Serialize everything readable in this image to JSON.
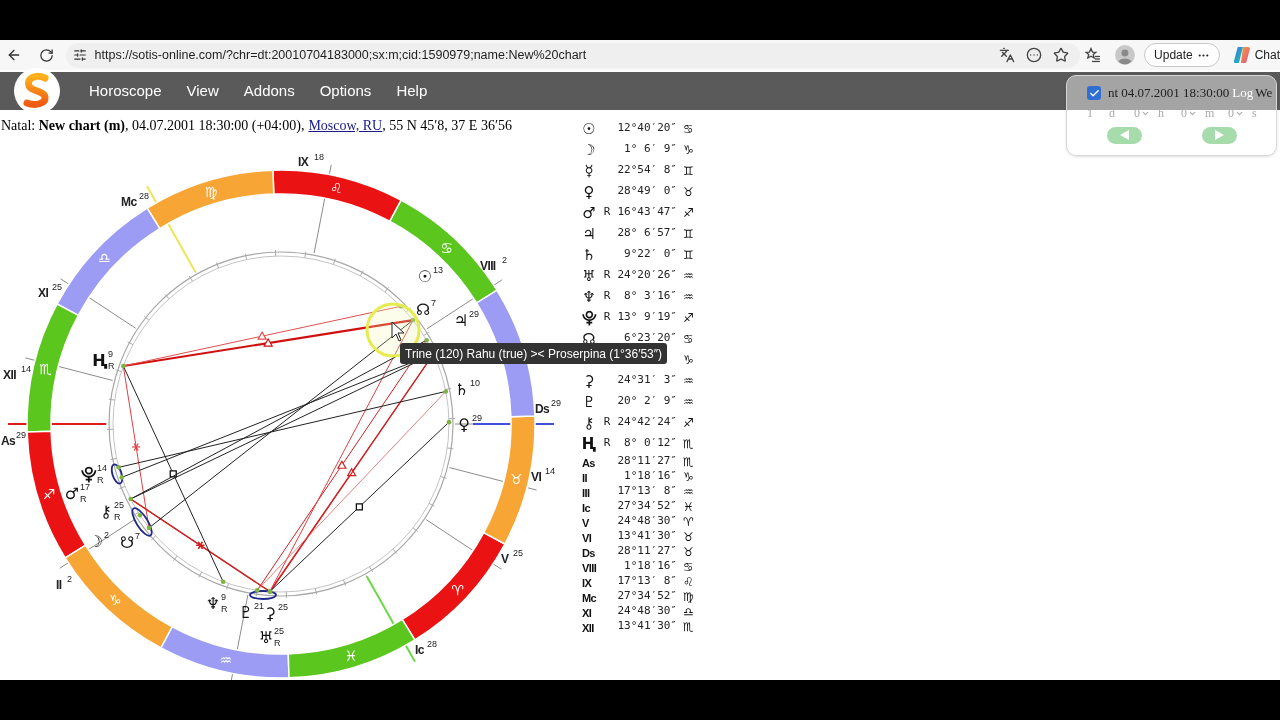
{
  "browser": {
    "url": "https://sotis-online.com/?chr=dt:20010704183000;sx:m;cid:1590979;name:New%20chart",
    "update_label": "Update",
    "chat_label": "Chat"
  },
  "menu": {
    "items": [
      "Horoscope",
      "View",
      "Addons",
      "Options",
      "Help"
    ],
    "login": "Log"
  },
  "time_panel": {
    "checked": true,
    "title": "nt 04.07.2001 18:30:00",
    "title_end": "We",
    "steps": [
      {
        "kind": "input",
        "value": "1",
        "unit": "d"
      },
      {
        "kind": "select",
        "value": "0",
        "unit": "h"
      },
      {
        "kind": "select",
        "value": "0",
        "unit": "m"
      },
      {
        "kind": "select",
        "value": "0",
        "unit": "s"
      }
    ]
  },
  "chart_info": {
    "text": "Natal: **New chart (m)**, 04.07.2001 18:30:00 (+04:00),",
    "place_link": "Moscow, RU",
    "coords": ", 55 N 45′8, 37 E 36′56"
  },
  "wheel": {
    "signs": [
      {
        "glyph": "♈",
        "color": "#ea1212"
      },
      {
        "glyph": "♉",
        "color": "#f7a534"
      },
      {
        "color": "#9c9cf5"
      },
      {
        "glyph": "♋",
        "color": "#5ac61e"
      },
      {
        "glyph": "♌",
        "color": "#ea1212"
      },
      {
        "glyph": "♍",
        "color": "#f7a534"
      },
      {
        "glyph": "♎",
        "color": "#9c9cf5"
      },
      {
        "glyph": "♏",
        "color": "#5ac61e"
      },
      {
        "glyph": "♐",
        "color": "#ea1212"
      },
      {
        "glyph": "♑",
        "color": "#f7a534"
      },
      {
        "glyph": "♒",
        "color": "#9c9cf5"
      },
      {
        "glyph": "♓",
        "color": "#5ac61e"
      }
    ],
    "houses": [
      {
        "label": "As",
        "degree": "29"
      },
      {
        "label": "II",
        "degree": "2"
      },
      {
        "label": "Ic",
        "degree": "28"
      },
      {
        "label": "V",
        "degree": "25"
      },
      {
        "label": "VI",
        "degree": "14"
      },
      {
        "label": "Ds",
        "degree": "29"
      },
      {
        "label": "VIII",
        "degree": "2"
      },
      {
        "label": "IX",
        "degree": "18"
      },
      {
        "label": "Mc",
        "degree": "28"
      },
      {
        "label": "XI",
        "degree": "25"
      },
      {
        "label": "XII",
        "degree": "14"
      }
    ],
    "planets": [
      {
        "glyph": "☉",
        "degree": "13"
      },
      {
        "glyph": "☊",
        "degree": "7"
      },
      {
        "glyph": "♃",
        "degree": "29"
      },
      {
        "glyph": "♄",
        "degree": "10"
      },
      {
        "glyph": "♀",
        "degree": "29"
      },
      {
        "glyph": "Ⱨ",
        "degree": "9",
        "retro": "R"
      },
      {
        "glyph": "⯓",
        "degree": "14",
        "retro": "R"
      },
      {
        "glyph": "♂",
        "degree": "17",
        "retro": "R"
      },
      {
        "glyph": "⚷",
        "degree": "25",
        "retro": "R"
      },
      {
        "glyph": "☽",
        "degree": "2"
      },
      {
        "glyph": "☋",
        "degree": "7"
      },
      {
        "glyph": "♆",
        "degree": "9",
        "retro": "R"
      },
      {
        "glyph": "♇",
        "degree": "21"
      },
      {
        "glyph": "⚳",
        "degree": "25"
      },
      {
        "glyph": "♅",
        "degree": "25",
        "retro": "R"
      }
    ],
    "tooltip": "Trine (120) Rahu (true) >< Proserpina (1°36′53″)"
  },
  "positions": [
    {
      "kind": "body",
      "glyph": "☉",
      "position": "12°40′20″",
      "sign": "♋"
    },
    {
      "kind": "body",
      "glyph": "☽",
      "position": "1° 6′ 9″",
      "sign": "♑"
    },
    {
      "kind": "body",
      "glyph": "☿",
      "position": "22°54′ 8″",
      "sign": "♊"
    },
    {
      "kind": "body",
      "glyph": "♀",
      "position": "28°49′ 0″",
      "sign": "♉"
    },
    {
      "kind": "body",
      "glyph": "♂",
      "retro": "R",
      "position": "16°43′47″",
      "sign": "♐"
    },
    {
      "kind": "body",
      "glyph": "♃",
      "position": "28° 6′57″",
      "sign": "♊"
    },
    {
      "kind": "body",
      "glyph": "♄",
      "position": "9°22′ 0″",
      "sign": "♊"
    },
    {
      "kind": "body",
      "glyph": "♅",
      "retro": "R",
      "position": "24°20′26″",
      "sign": "♒"
    },
    {
      "kind": "body",
      "glyph": "♆",
      "retro": "R",
      "position": "8° 3′16″",
      "sign": "♒"
    },
    {
      "kind": "body",
      "glyph": "⯓",
      "retro": "R",
      "position": "13° 9′19″",
      "sign": "♐"
    },
    {
      "kind": "body",
      "glyph": "☊",
      "position": "6°23′20″",
      "sign": "♋"
    },
    {
      "kind": "body",
      "sign": "♑"
    },
    {
      "kind": "body",
      "glyph": "⚳",
      "position": "24°31′ 3″",
      "sign": "♒"
    },
    {
      "kind": "body",
      "glyph": "♇",
      "position": "20° 2′ 9″",
      "sign": "♒"
    },
    {
      "kind": "body",
      "glyph": "⚷",
      "retro": "R",
      "position": "24°42′24″",
      "sign": "♐"
    },
    {
      "kind": "body",
      "glyph": "Ⱨ",
      "retro": "R",
      "position": "8° 0′12″",
      "sign": "♏"
    },
    {
      "kind": "cusp",
      "label": "As",
      "position": "28°11′27″",
      "sign": "♏"
    },
    {
      "kind": "cusp",
      "label": "II",
      "position": "1°18′16″",
      "sign": "♑"
    },
    {
      "kind": "cusp",
      "label": "III",
      "position": "17°13′ 8″",
      "sign": "♒"
    },
    {
      "kind": "cusp",
      "label": "Ic",
      "position": "27°34′52″",
      "sign": "♓"
    },
    {
      "kind": "cusp",
      "label": "V",
      "position": "24°48′30″",
      "sign": "♈"
    },
    {
      "kind": "cusp",
      "label": "VI",
      "position": "13°41′30″",
      "sign": "♉"
    },
    {
      "kind": "cusp",
      "label": "Ds",
      "position": "28°11′27″",
      "sign": "♉"
    },
    {
      "kind": "cusp",
      "label": "VIII",
      "position": "1°18′16″",
      "sign": "♋"
    },
    {
      "kind": "cusp",
      "label": "IX",
      "position": "17°13′ 8″",
      "sign": "♌"
    },
    {
      "kind": "cusp",
      "label": "Mc",
      "position": "27°34′52″",
      "sign": "♍"
    },
    {
      "kind": "cusp",
      "label": "XI",
      "position": "24°48′30″",
      "sign": "♎"
    },
    {
      "kind": "cusp",
      "label": "XII",
      "position": "13°41′30″",
      "sign": "♏"
    }
  ]
}
